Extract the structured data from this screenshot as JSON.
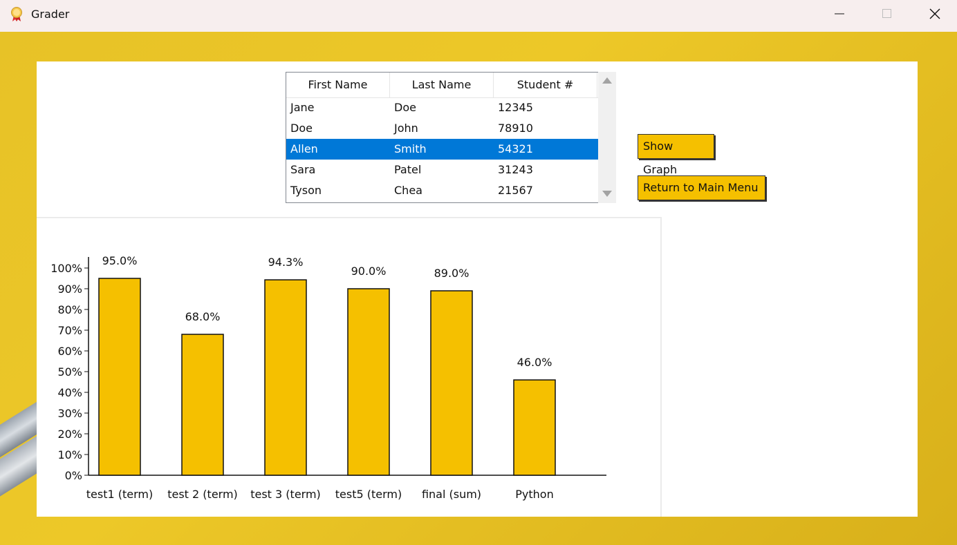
{
  "window": {
    "title": "Grader",
    "icon": "ribbon-badge-icon",
    "controls": [
      "minimize-icon",
      "maximize-icon",
      "close-icon"
    ]
  },
  "table": {
    "headers": [
      "First Name",
      "Last Name",
      "Student #"
    ],
    "rows": [
      [
        "Jane",
        "Doe",
        "12345"
      ],
      [
        "Doe",
        "John",
        "78910"
      ],
      [
        "Allen",
        "Smith",
        "54321"
      ],
      [
        "Sara",
        "Patel",
        "31243"
      ],
      [
        "Tyson",
        "Chea",
        "21567"
      ]
    ],
    "selected_row": 2
  },
  "buttons": {
    "show_graph": "Show Graph",
    "return_menu": "Return to Main Menu"
  },
  "colors": {
    "accent": "#f5c000",
    "selection": "#0078d7",
    "background": "#e8c41f"
  },
  "chart_data": {
    "type": "bar",
    "categories": [
      "test1 (term)",
      "test 2 (term)",
      "test 3 (term)",
      "test5 (term)",
      "final (sum)",
      "Python"
    ],
    "values": [
      95.0,
      68.0,
      94.3,
      90.0,
      89.0,
      46.0
    ],
    "data_labels": [
      "95.0%",
      "68.0%",
      "94.3%",
      "90.0%",
      "89.0%",
      "46.0%"
    ],
    "yticks": [
      "0%",
      "10%",
      "20%",
      "30%",
      "40%",
      "50%",
      "60%",
      "70%",
      "80%",
      "90%",
      "100%"
    ],
    "ylim": [
      0,
      100
    ],
    "bar_color": "#f5c000",
    "grid": false,
    "legend": "none"
  }
}
